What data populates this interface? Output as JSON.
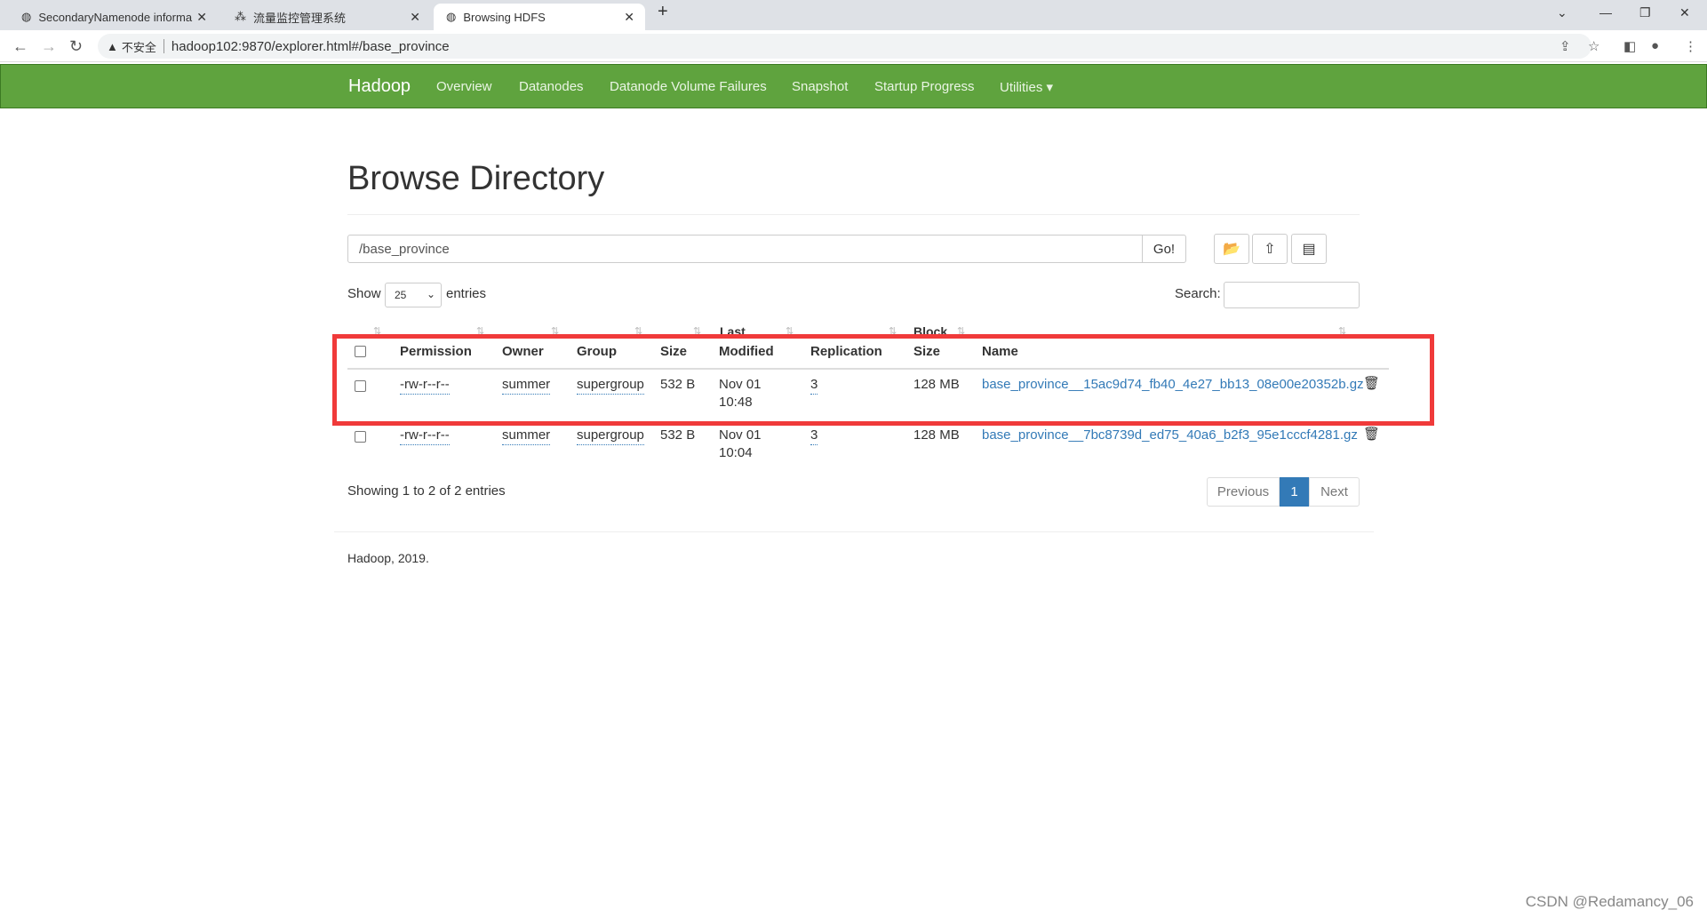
{
  "browser": {
    "tabs": [
      {
        "title": "SecondaryNamenode informa"
      },
      {
        "title": "流量监控管理系统"
      },
      {
        "title": "Browsing HDFS"
      }
    ],
    "security": "不安全",
    "url": "hadoop102:9870/explorer.html#/base_province"
  },
  "navbar": {
    "brand": "Hadoop",
    "items": [
      "Overview",
      "Datanodes",
      "Datanode Volume Failures",
      "Snapshot",
      "Startup Progress",
      "Utilities ▾"
    ],
    "color": "#5fa33e"
  },
  "page": {
    "title": "Browse Directory",
    "path": "/base_province",
    "go": "Go!",
    "show_label": "Show",
    "entries_value": "25",
    "entries_label": "entries",
    "search_label": "Search:",
    "clipped_headers": {
      "last": "Last",
      "block": "Block"
    },
    "columns": [
      "Permission",
      "Owner",
      "Group",
      "Size",
      "Modified",
      "Replication",
      "Size",
      "Name"
    ],
    "rows": [
      {
        "permission": "-rw-r--r--",
        "owner": "summer",
        "group": "supergroup",
        "size": "532 B",
        "date": "Nov 01",
        "time": "10:48",
        "replication": "3",
        "block_size": "128 MB",
        "name": "base_province__15ac9d74_fb40_4e27_bb13_08e00e20352b.gz"
      },
      {
        "permission": "-rw-r--r--",
        "owner": "summer",
        "group": "supergroup",
        "size": "532 B",
        "date": "Nov 01",
        "time": "10:04",
        "replication": "3",
        "block_size": "128 MB",
        "name": "base_province__7bc8739d_ed75_40a6_b2f3_95e1cccf4281.gz"
      }
    ],
    "showing": "Showing 1 to 2 of 2 entries",
    "pagination": {
      "previous": "Previous",
      "current": "1",
      "next": "Next"
    },
    "footer": "Hadoop, 2019."
  },
  "watermark": "CSDN @Redamancy_06"
}
